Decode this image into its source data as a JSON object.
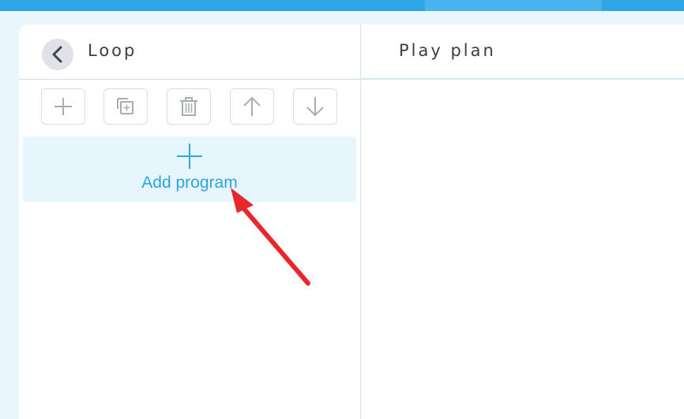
{
  "header": {
    "left_title": "Loop",
    "right_title": "Play plan"
  },
  "toolbar": {
    "buttons": [
      {
        "icon": "plus-icon"
      },
      {
        "icon": "copy-icon"
      },
      {
        "icon": "trash-icon"
      },
      {
        "icon": "arrow-up-icon"
      },
      {
        "icon": "arrow-down-icon"
      }
    ]
  },
  "program_list": {
    "add_label": "Add program"
  },
  "colors": {
    "accent": "#2fa6e6",
    "add_label": "#2aa5e4",
    "annotation": "#e8262b"
  }
}
